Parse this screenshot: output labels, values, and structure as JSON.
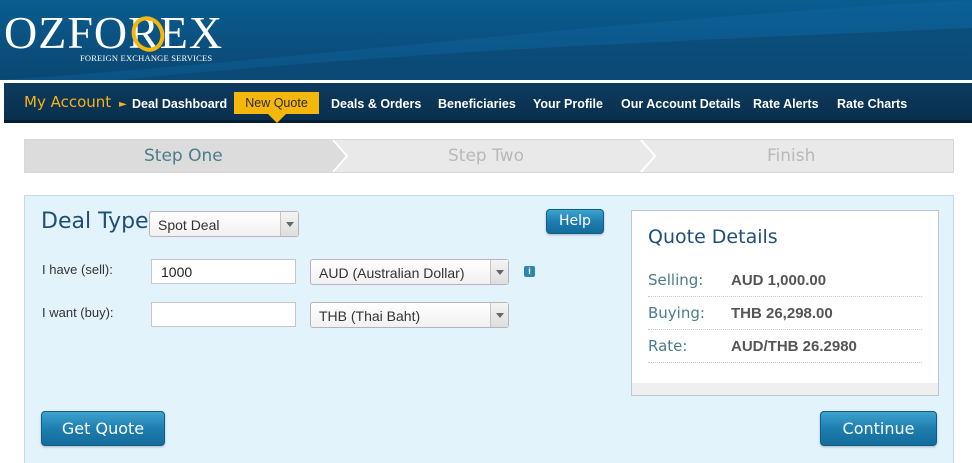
{
  "logo": {
    "name": "OZFOREX",
    "tagline": "FOREIGN EXCHANGE SERVICES"
  },
  "nav": {
    "my_account": "My Account",
    "items": [
      "Deal Dashboard",
      "New Quote",
      "Deals & Orders",
      "Beneficiaries",
      "Your Profile",
      "Our Account Details",
      "Rate Alerts",
      "Rate Charts"
    ],
    "active": "New Quote"
  },
  "steps": [
    "Step One",
    "Step Two",
    "Finish"
  ],
  "deal": {
    "type_label": "Deal Type:",
    "type_value": "Spot Deal",
    "help_label": "Help",
    "have_label": "I have (sell):",
    "have_amount": "1000",
    "have_currency": "AUD (Australian Dollar)",
    "want_label": "I want (buy):",
    "want_amount": "",
    "want_currency": "THB (Thai Baht)",
    "info_icon": "i"
  },
  "quote": {
    "title": "Quote Details",
    "rows": [
      {
        "label": "Selling:",
        "value": "AUD 1,000.00"
      },
      {
        "label": "Buying:",
        "value": "THB 26,298.00"
      },
      {
        "label": "Rate:",
        "value": "AUD/THB 26.2980"
      }
    ]
  },
  "actions": {
    "get_quote": "Get Quote",
    "continue": "Continue"
  },
  "colors": {
    "header": "#0b4f7e",
    "nav": "#0c3b5e",
    "accent": "#f5b70b",
    "panel": "#e3f3fb",
    "button": "#1d7eaf"
  },
  "icons": [
    "chevron-right-icon",
    "dropdown-arrow-icon",
    "info-icon"
  ]
}
